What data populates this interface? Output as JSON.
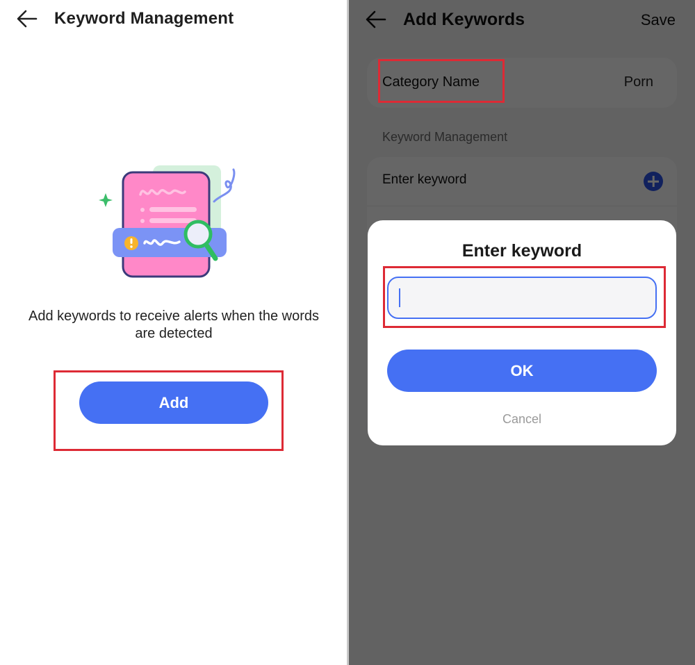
{
  "left_screen": {
    "header": {
      "title": "Keyword Management",
      "back_icon": "arrow-left-icon"
    },
    "illustration": "keyword-alert-illustration",
    "description": "Add keywords to receive alerts when the words are detected",
    "add_button": "Add"
  },
  "right_screen": {
    "header": {
      "title": "Add Keywords",
      "save_label": "Save",
      "back_icon": "arrow-left-icon"
    },
    "category": {
      "label": "Category Name",
      "value": "Porn"
    },
    "section_label": "Keyword Management",
    "keyword_row": {
      "label": "Enter keyword",
      "icon": "plus-circle-icon"
    },
    "dialog": {
      "title": "Enter keyword",
      "input_value": "",
      "ok_label": "OK",
      "cancel_label": "Cancel"
    }
  },
  "colors": {
    "accent": "#4570f3",
    "highlight": "#dd2a35",
    "overlay": "#646464"
  }
}
